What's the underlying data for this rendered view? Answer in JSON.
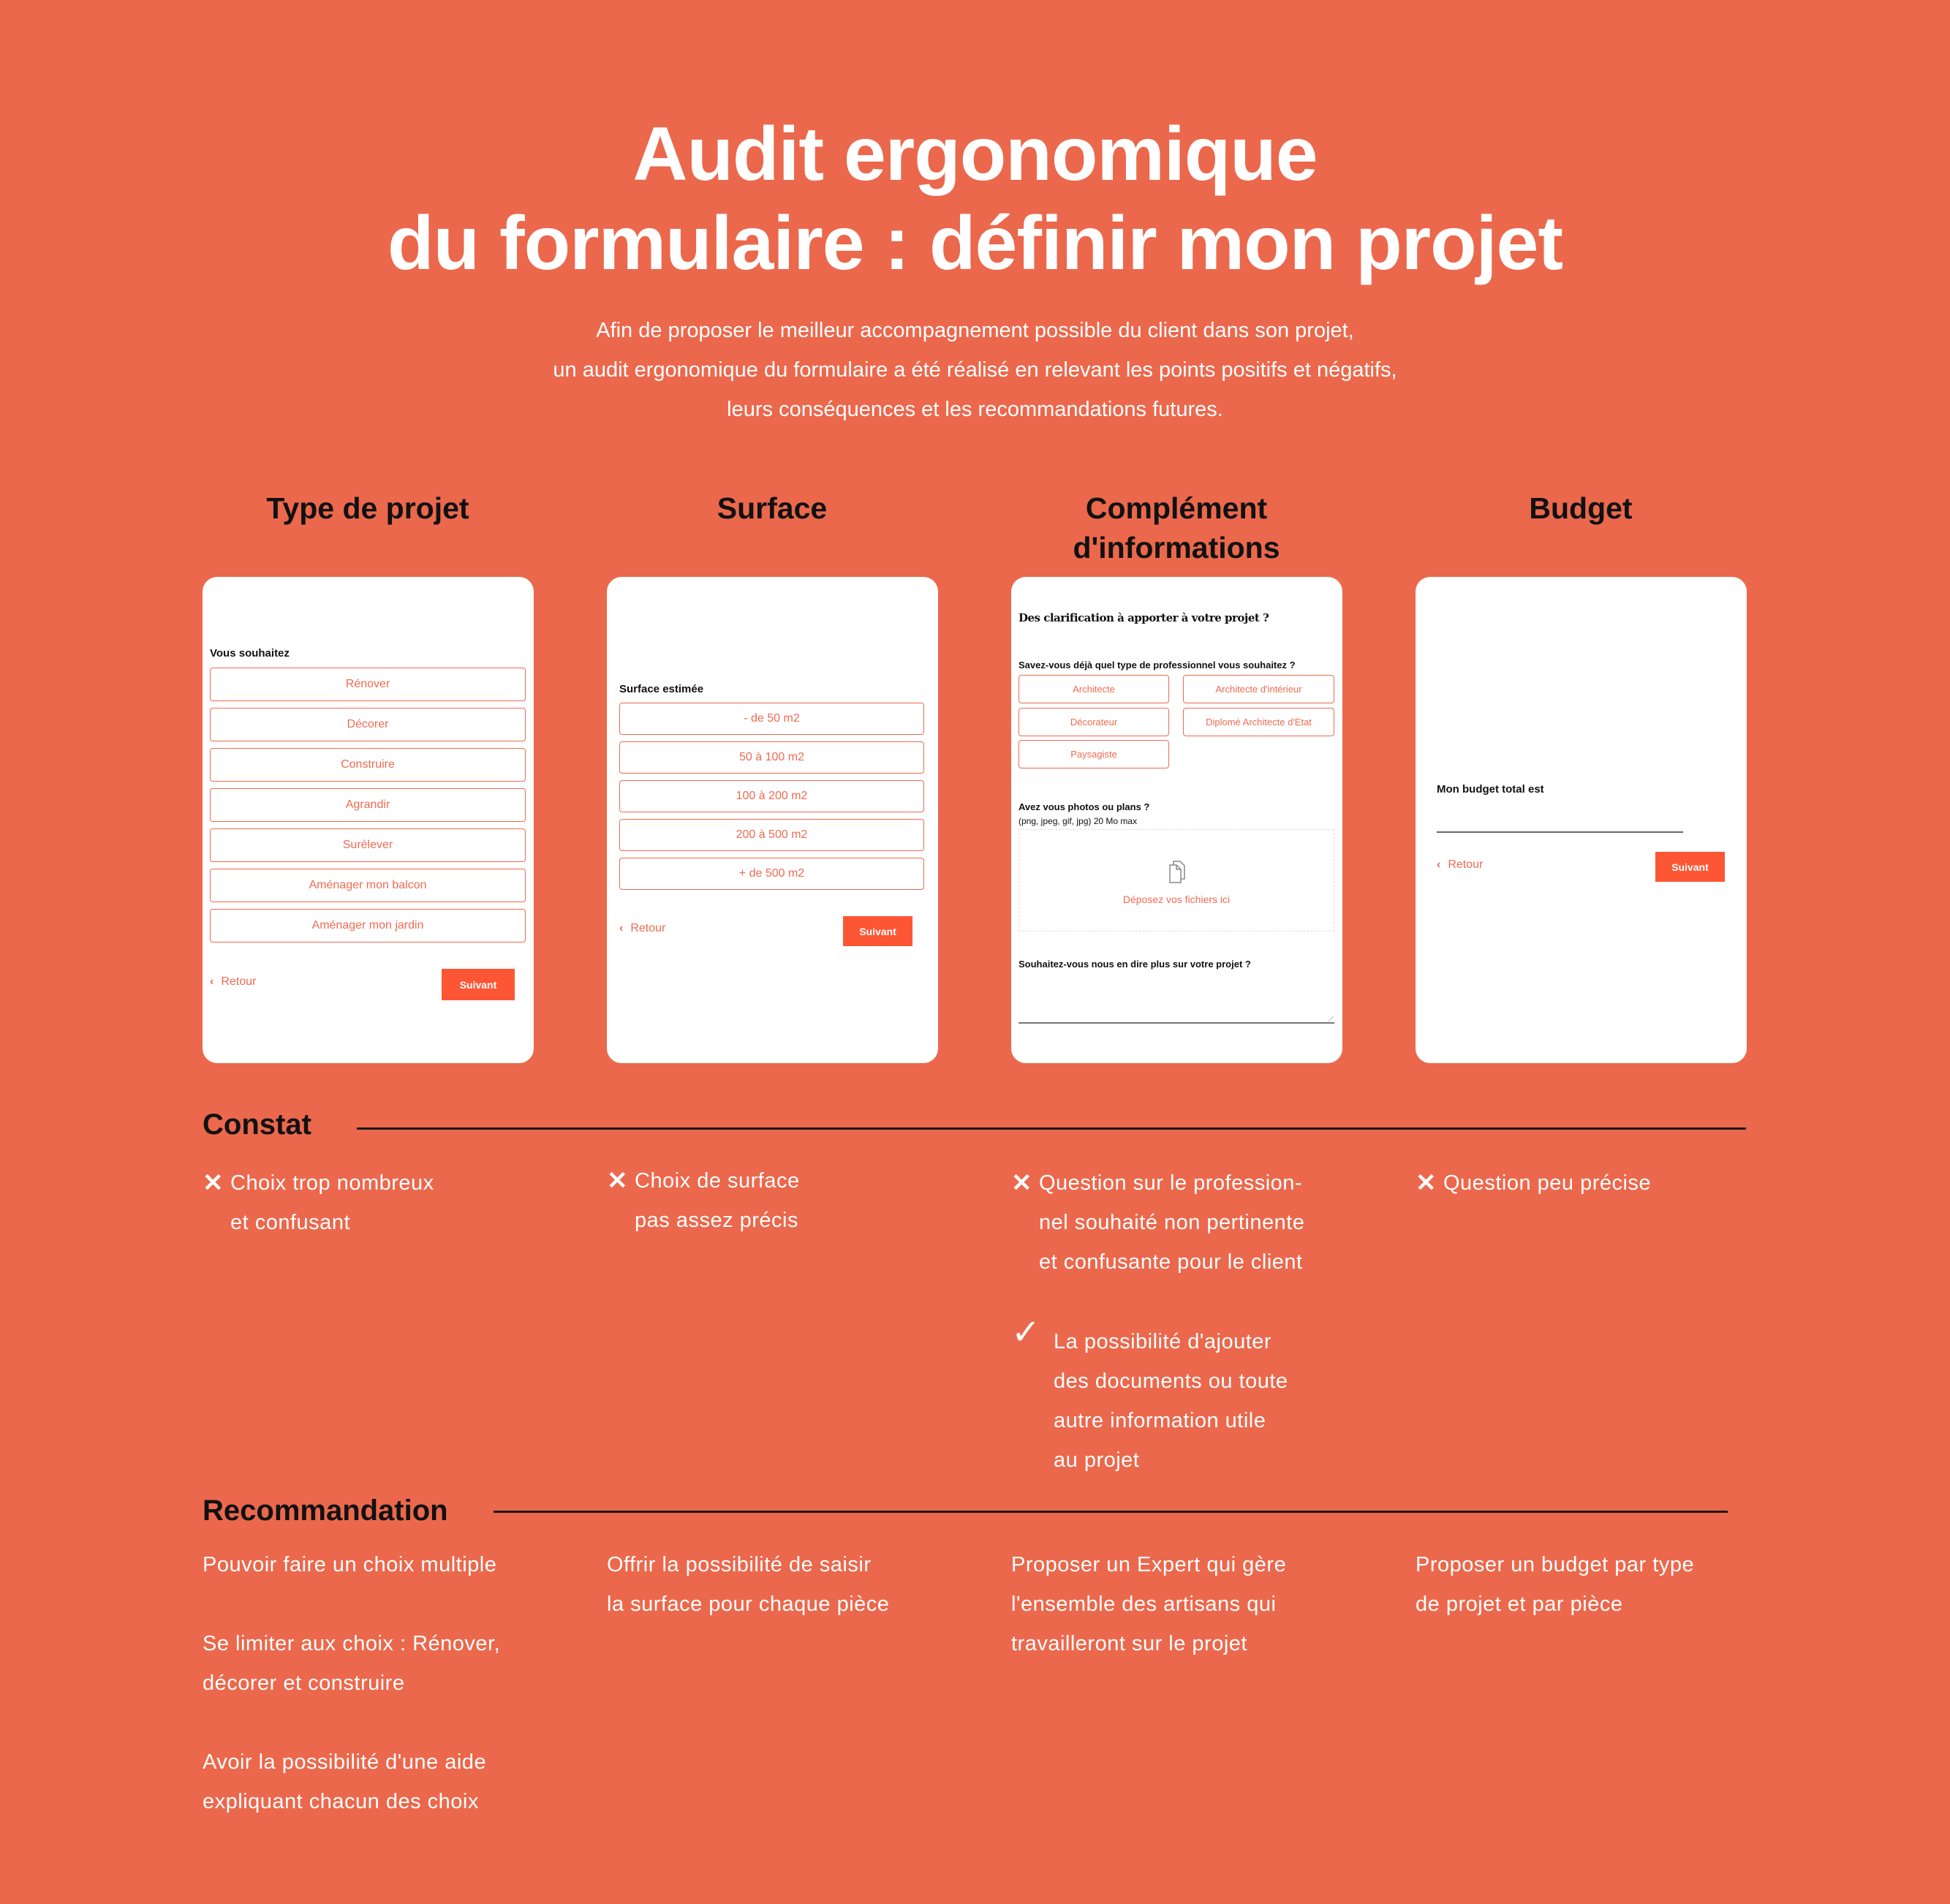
{
  "header": {
    "title_line1": "Audit ergonomique",
    "title_line2": "du formulaire : définir mon projet",
    "subtitle_lines": [
      "Afin de proposer le meilleur accompagnement possible du client dans son projet,",
      "un audit ergonomique du formulaire a été réalisé en relevant les points positifs et négatifs,",
      "leurs conséquences et les recommandations futures."
    ]
  },
  "colors": {
    "background": "#EB684C",
    "accent": "#FD5634",
    "option_border": "#F06A52"
  },
  "columns": [
    {
      "heading": "Type de projet"
    },
    {
      "heading": "Surface"
    },
    {
      "heading_line1": "Complément",
      "heading_line2": "d'informations"
    },
    {
      "heading": "Budget"
    }
  ],
  "cards": {
    "type_projet": {
      "label": "Vous souhaitez",
      "options": [
        "Rénover",
        "Décorer",
        "Construire",
        "Agrandir",
        "Surélever",
        "Aménager mon balcon",
        "Aménager mon jardin"
      ],
      "back_label": "Retour",
      "next_label": "Suivant"
    },
    "surface": {
      "label": "Surface estimée",
      "options": [
        "- de 50 m2",
        "50 à 100 m2",
        "100 à 200 m2",
        "200 à 500 m2",
        "+ de 500 m2"
      ],
      "back_label": "Retour",
      "next_label": "Suivant"
    },
    "complement": {
      "title": "Des clarification à apporter à votre projet ?",
      "pro_question": "Savez-vous déjà quel type de professionnel vous souhaitez ?",
      "pro_options": [
        "Architecte",
        "Architecte d'intérieur",
        "Décorateur",
        "Diplomé Architecte d'Etat",
        "Paysagiste"
      ],
      "photos_question": "Avez vous photos ou plans ?",
      "photos_hint": "(png, jpeg, gif, jpg) 20 Mo max",
      "dropzone_label": "Déposez vos fichiers ici",
      "more_question": "Souhaitez-vous nous en dire plus sur votre projet ?",
      "more_value": ""
    },
    "budget": {
      "label": "Mon budget total est",
      "value": "",
      "back_label": "Retour",
      "next_label": "Suivant"
    }
  },
  "constat": {
    "heading": "Constat",
    "columns": [
      [
        {
          "type": "negative",
          "lines": [
            "Choix trop nombreux",
            "et confusant"
          ]
        }
      ],
      [
        {
          "type": "negative",
          "lines": [
            "Choix de surface",
            "pas assez précis"
          ]
        }
      ],
      [
        {
          "type": "negative",
          "lines": [
            "Question sur le profession-",
            "nel souhaité non pertinente",
            "et confusante pour le client"
          ]
        },
        {
          "type": "positive",
          "lines": [
            "La possibilité d'ajouter",
            "des documents ou toute",
            "autre information utile",
            "au projet"
          ]
        }
      ],
      [
        {
          "type": "negative",
          "lines": [
            "Question peu précise"
          ]
        }
      ]
    ],
    "icons": {
      "negative": "✕",
      "positive": "✓"
    }
  },
  "recommandation": {
    "heading": "Recommandation",
    "columns": [
      [
        [
          "Pouvoir faire un choix multiple"
        ],
        [
          "Se limiter aux choix : Rénover,",
          "décorer et construire"
        ],
        [
          "Avoir la possibilité d'une aide",
          "expliquant chacun des choix"
        ]
      ],
      [
        [
          "Offrir la possibilité de saisir",
          "la surface pour chaque pièce"
        ]
      ],
      [
        [
          "Proposer un Expert qui gère",
          "l'ensemble des artisans qui",
          "travailleront sur le projet"
        ]
      ],
      [
        [
          "Proposer un budget par type",
          "de projet et par pièce"
        ]
      ]
    ]
  }
}
